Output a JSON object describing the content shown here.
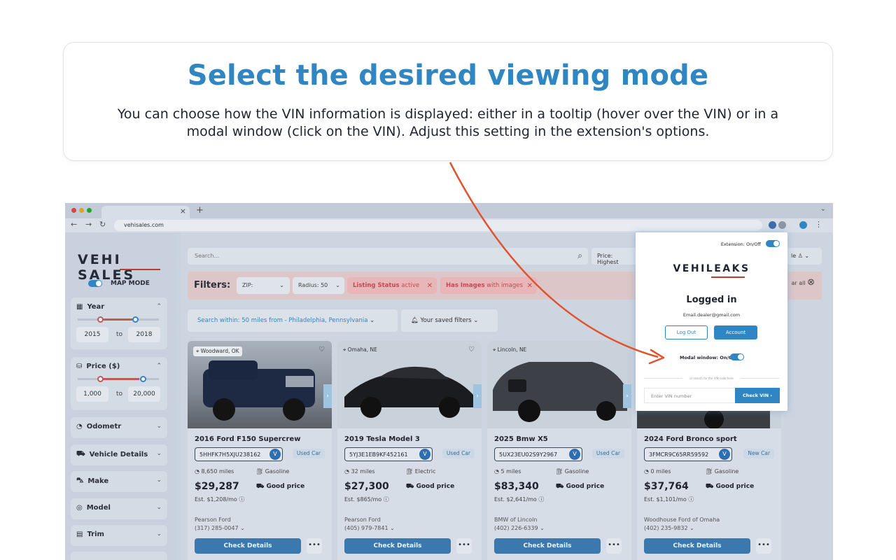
{
  "hero": {
    "title": "Select the desired viewing mode",
    "description": "You can choose how the VIN information is displayed: either in a tooltip (hover over the VIN) or in a modal window (click on the VIN). Adjust this setting in the extension's options."
  },
  "browser": {
    "tab_close": "×",
    "tab_plus": "+",
    "url": "vehisales.com"
  },
  "sidebar": {
    "logo": "VEHI SALES",
    "map_mode": "MAP MODE",
    "year": {
      "label": "Year",
      "from": "2015",
      "to_label": "to",
      "to": "2018"
    },
    "price": {
      "label": "Price ($)",
      "from": "1,000",
      "to_label": "to",
      "to": "20,000"
    },
    "sections": [
      "Odometr",
      "Vehicle Details",
      "Make",
      "Model",
      "Trim"
    ]
  },
  "header": {
    "search_placeholder": "Search...",
    "sort": "Price: Highest",
    "user_fragment": "le"
  },
  "filters": {
    "label": "Filters:",
    "zip": "ZIP:",
    "radius": "Radius: 50",
    "chip1_key": "Listing Status",
    "chip1_val": "active",
    "chip2_key": "Has Images",
    "chip2_val": "with images",
    "clear": "ar all"
  },
  "search_within": {
    "label": "Search within:",
    "value": "50 miles from - Philadelphia, Pennsylvania",
    "saved": "Your saved filters"
  },
  "cards": [
    {
      "location": "Woodward, OK",
      "name": "2016 Ford F150 Supercrew",
      "vin": "5HHFK7H5XJU238162",
      "condition": "Used Car",
      "miles": "8,650 miles",
      "fuel": "Gasoline",
      "price": "$29,287",
      "rating": "Good price",
      "monthly": "Est. $1,208/mo",
      "dealer": "Pearson Ford",
      "phone": "(317) 285-0047",
      "cta": "Check Details",
      "more": "•••"
    },
    {
      "location": "Omaha, NE",
      "name": "2019 Tesla Model 3",
      "vin": "5YJ3E1EB9KF452161",
      "condition": "Used Car",
      "miles": "32 miles",
      "fuel": "Electric",
      "price": "$27,300",
      "rating": "Good price",
      "monthly": "Est. $865/mo",
      "dealer": "Pearson Ford",
      "phone": "(405) 979-7841",
      "cta": "Check Details",
      "more": "•••"
    },
    {
      "location": "Lincoln, NE",
      "name": "2025 Bmw X5",
      "vin": "5UX23EU02S9Y2967",
      "condition": "Used Car",
      "miles": "5 miles",
      "fuel": "Gasoline",
      "price": "$83,340",
      "rating": "Good price",
      "monthly": "Est. $2,641/mo",
      "dealer": "BMW of Lincoln",
      "phone": "(402) 226-6339",
      "cta": "Check Details",
      "more": "•••"
    },
    {
      "location": "",
      "name": "2024 Ford Bronco sport",
      "vin": "3FMCR9C65RR59592",
      "condition": "New Car",
      "miles": "0 miles",
      "fuel": "Gasoline",
      "price": "$37,764",
      "rating": "Good price",
      "monthly": "Est. $1,101/mo",
      "dealer": "Woodhouse Ford of Omaha",
      "phone": "(402) 235-9832",
      "cta": "Check Details",
      "more": "•••"
    }
  ],
  "popup": {
    "extension": "Extension: On/Off",
    "logo": "VEHILEAKS",
    "status": "Logged in",
    "email": "Email.dealer@gmail.com",
    "logout": "Log Out",
    "account": "Account",
    "modal_toggle": "Modal window: On/Off",
    "divider": "or search for the VIN code here",
    "vin_placeholder": "Enter VIN number",
    "check": "Check VIN ›"
  },
  "colors": {
    "accent": "#2f86c2",
    "arrow": "#e0532e",
    "brand_red": "#c0392b"
  }
}
